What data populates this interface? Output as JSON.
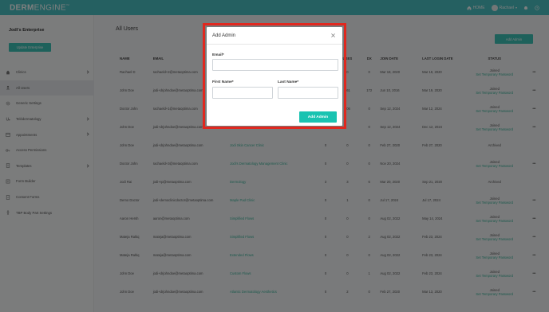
{
  "app": {
    "logo_bold": "DERM",
    "logo_light": "ENGINE",
    "logo_mark": "™",
    "home_label": "HOME",
    "user_label": "Rachael"
  },
  "sidebar": {
    "org_name": "Jodi's Enterprise",
    "org_button": "Update Enterprise",
    "items": [
      {
        "label": "Clinics",
        "icon": "clinic-icon",
        "chevron": true
      },
      {
        "label": "All Users",
        "icon": "users-icon",
        "chevron": false,
        "active": true
      },
      {
        "label": "Generic Settings",
        "icon": "gear-icon",
        "chevron": false
      },
      {
        "label": "Telédermatology",
        "icon": "stethoscope-icon",
        "chevron": true
      },
      {
        "label": "Appointments",
        "icon": "calendar-icon",
        "chevron": true
      },
      {
        "label": "Access Permissions",
        "icon": "key-icon",
        "chevron": false
      },
      {
        "label": "Templates",
        "icon": "template-icon",
        "chevron": true
      },
      {
        "label": "Form Builder",
        "icon": "form-icon",
        "chevron": false
      },
      {
        "label": "Consent Forms",
        "icon": "consent-icon",
        "chevron": false
      },
      {
        "label": "TBP Body Part Settings",
        "icon": "body-icon",
        "chevron": false
      }
    ]
  },
  "main": {
    "title": "All Users",
    "add_admin_button": "Add Admin",
    "columns": [
      "NAME",
      "EMAIL",
      "",
      "",
      "USES",
      "DX",
      "JOIN DATE",
      "LAST LOGIN DATE",
      "STATUS"
    ],
    "rows": [
      {
        "name": "Rachael D",
        "email": "rachaeld+2@metaoptima.com",
        "clinic": "",
        "n1": "",
        "n2": "0",
        "n3": "0",
        "join": "Mar 18, 2020",
        "last": "Mar 19, 2020",
        "status": "Joined",
        "pw": "Set Temporary Password"
      },
      {
        "name": "John Doe",
        "email": "jodi+drjohndoe@metaoptima.com",
        "clinic": "",
        "n1": "",
        "n2": "361",
        "n3": "172",
        "join": "Jun 10, 2016",
        "last": "Mar 19, 2020",
        "status": "Joined",
        "pw": "Set Temporary Password"
      },
      {
        "name": "Doctor John",
        "email": "rachaeld+1@metaoptima.com",
        "clinic": "",
        "n1": "",
        "n2": "306",
        "n3": "0",
        "join": "Sep 12, 2024",
        "last": "Mar 12, 2024",
        "status": "Joined",
        "pw": "Set Temporary Password"
      },
      {
        "name": "John Doe",
        "email": "jodi+drjohndoe@metaoptima.com",
        "clinic": "",
        "n1": "",
        "n2": "",
        "n3": "0",
        "join": "Sep 12, 2024",
        "last": "Dec 12, 2024",
        "status": "Joined",
        "pw": "Set Temporary Password"
      },
      {
        "name": "John Doe",
        "email": "jodi+drjohndoe@metaoptima.com",
        "clinic": "Jodi Skin Cancer Clinic",
        "n1": "0",
        "n2": "0",
        "n3": "0",
        "join": "Feb 27, 2020",
        "last": "Feb 27, 2020",
        "status": "Archived",
        "pw": ""
      },
      {
        "name": "Doctor John",
        "email": "rachaeld+3@metaoptima.com",
        "clinic": "Jodi's Dermatology Management Clinic",
        "n1": "0",
        "n2": "0",
        "n3": "0",
        "join": "Nov 20, 2024",
        "last": "",
        "status": "Joined",
        "pw": "Set Temporary Password"
      },
      {
        "name": "Jodi Rai",
        "email": "jodi+rp@metaoptima.com",
        "clinic": "Dermology",
        "n1": "3",
        "n2": "3",
        "n3": "6",
        "join": "Mar 20, 2020",
        "last": "Sep 21, 2020",
        "status": "Archived",
        "pw": ""
      },
      {
        "name": "Demo Doctor",
        "email": "jodi+democlinicdoctor@metaoptima.com",
        "clinic": "Maple Pad Clinic",
        "n1": "0",
        "n2": "1",
        "n3": "0",
        "join": "Jul 17, 2024",
        "last": "Jul 17, 2024",
        "status": "Joined",
        "pw": "Set Temporary Password"
      },
      {
        "name": "Aaron Hersh",
        "email": "aaron@metaoptima.com",
        "clinic": "Simplified Flows",
        "n1": "0",
        "n2": "0",
        "n3": "0",
        "join": "Aug 02, 2022",
        "last": "May 14, 2024",
        "status": "Joined",
        "pw": "Set Temporary Password"
      },
      {
        "name": "Mateja Raltiq",
        "email": "mateja@metaoptima.com",
        "clinic": "Simplified Flows",
        "n1": "0",
        "n2": "0",
        "n3": "2",
        "join": "Aug 02, 2022",
        "last": "Feb 23, 2024",
        "status": "Joined",
        "pw": "Set Temporary Password"
      },
      {
        "name": "Mateja Raltiq",
        "email": "mateja@metaoptima.com",
        "clinic": "Extended Flows",
        "n1": "0",
        "n2": "0",
        "n3": "0",
        "join": "Aug 02, 2022",
        "last": "Feb 23, 2024",
        "status": "Joined",
        "pw": "Set Temporary Password"
      },
      {
        "name": "John Doe",
        "email": "jodi+drjohndoe@metaoptima.com",
        "clinic": "Custom Flows",
        "n1": "0",
        "n2": "0",
        "n3": "1",
        "join": "Aug 02, 2022",
        "last": "Feb 23, 2024",
        "status": "Joined",
        "pw": "Set Temporary Password"
      },
      {
        "name": "John Doe",
        "email": "jodi+drjohndoe@metaoptima.com",
        "clinic": "Atlantic Dermatology Aesthetics",
        "n1": "0",
        "n2": "2",
        "n3": "0",
        "join": "Feb 27, 2020",
        "last": "Mar 13, 2020",
        "status": "Joined",
        "pw": "Set Temporary Password"
      }
    ]
  },
  "modal": {
    "title": "Add Admin",
    "email_label": "Email*",
    "email_value": "",
    "first_name_label": "First Name*",
    "first_name_value": "",
    "last_name_label": "Last Name*",
    "last_name_value": "",
    "submit_label": "Add Admin"
  },
  "colors": {
    "brand": "#4ac0c2",
    "accent": "#19c3b1",
    "highlight_frame": "#e0281f"
  }
}
